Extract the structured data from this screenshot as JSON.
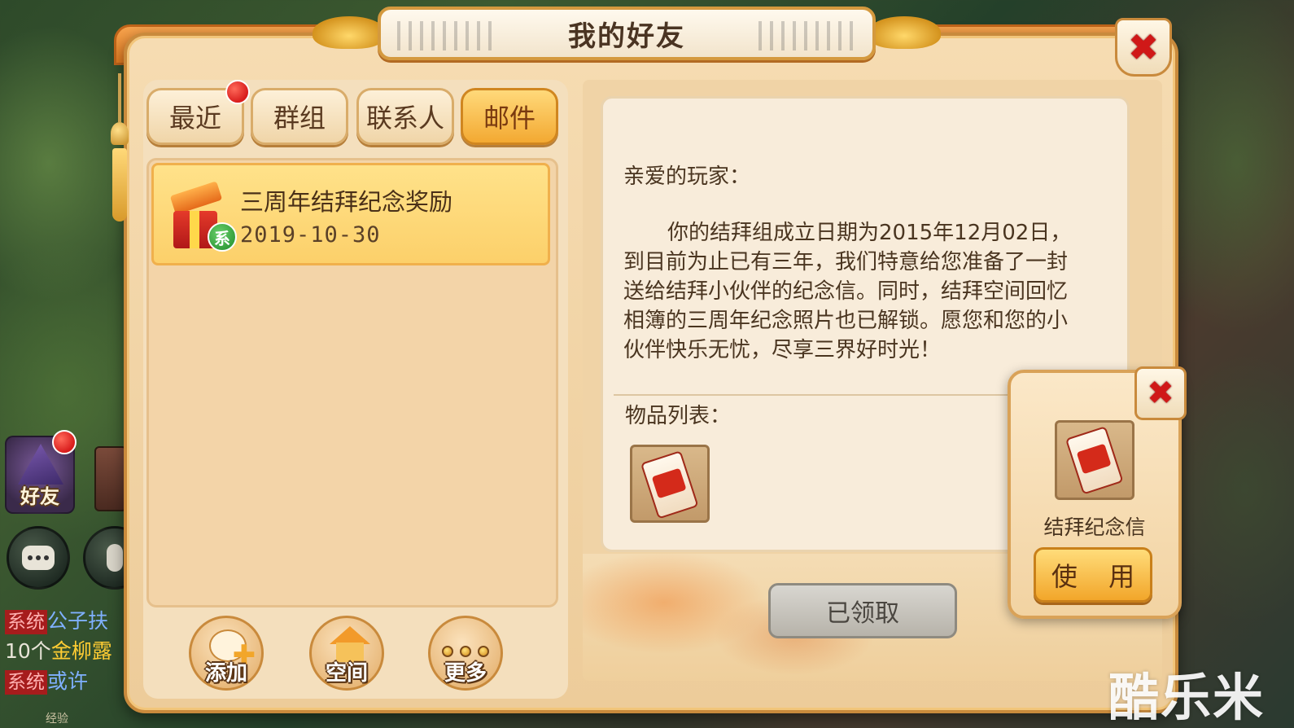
{
  "window": {
    "title": "我的好友"
  },
  "tabs": [
    {
      "label": "最近",
      "active": false,
      "has_notification": true
    },
    {
      "label": "群组",
      "active": false,
      "has_notification": false
    },
    {
      "label": "联系人",
      "active": false,
      "has_notification": false
    },
    {
      "label": "邮件",
      "active": true,
      "has_notification": false
    }
  ],
  "mail_list": [
    {
      "title": "三周年结拜纪念奖励",
      "date": "2019-10-30",
      "badge": "系",
      "icon": "gift-box-icon",
      "selected": true
    }
  ],
  "actions": [
    {
      "label": "添加",
      "icon": "add-friend-icon"
    },
    {
      "label": "空间",
      "icon": "house-icon"
    },
    {
      "label": "更多",
      "icon": "more-dots-icon"
    }
  ],
  "letter": {
    "salutation": "亲爱的玩家：",
    "body": "你的结拜组成立日期为2015年12月02日，到目前为止已有三年，我们特意给您准备了一封送给结拜小伙伴的纪念信。同时，结拜空间回忆相簿的三周年纪念照片也已解锁。愿您和您的小伙伴快乐无忧，尽享三界好时光！",
    "items_label": "物品列表：",
    "items": [
      {
        "icon": "commemorative-letter-icon"
      }
    ],
    "received_button": "已领取"
  },
  "popup": {
    "item_name": "结拜纪念信",
    "use_button": "使 用"
  },
  "hud": {
    "friend_label": "好友",
    "chat_lines": [
      {
        "tag": "系统",
        "text": "公子扶"
      },
      {
        "prefix": "10个",
        "highlight": "金柳露"
      },
      {
        "tag": "系统",
        "text": "或许"
      }
    ],
    "exp_label": "经验"
  },
  "watermark": "酷乐米",
  "colors": {
    "accent_orange": "#f2a62a",
    "close_red": "#d01818",
    "selected_item": "#fcd06a",
    "badge_green": "#1f8a2a"
  }
}
